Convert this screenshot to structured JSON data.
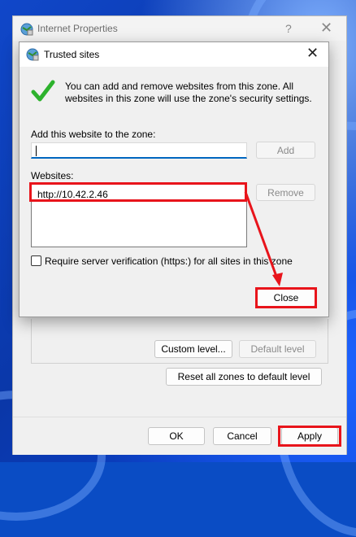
{
  "parent_window": {
    "title": "Internet Properties",
    "help_glyph": "?",
    "close_glyph": "✕",
    "custom_level_label": "Custom level...",
    "default_level_label": "Default level",
    "reset_all_label": "Reset all zones to default level",
    "ok_label": "OK",
    "cancel_label": "Cancel",
    "apply_label": "Apply"
  },
  "dialog": {
    "title": "Trusted sites",
    "close_glyph": "✕",
    "info_text": "You can add and remove websites from this zone. All websites in this zone will use the zone's security settings.",
    "add_site_label": "Add this website to the zone:",
    "add_site_value": "",
    "add_button_label": "Add",
    "websites_label": "Websites:",
    "websites": [
      "http://10.42.2.46"
    ],
    "remove_button_label": "Remove",
    "require_https_label": "Require server verification (https:) for all sites in this zone",
    "require_https_checked": false,
    "close_button_label": "Close"
  },
  "colors": {
    "highlight": "#e8141b",
    "accent": "#0067c0",
    "check_green": "#2db22d"
  },
  "icons": {
    "window_icon": "internet-options-icon",
    "check_icon": "green-checkmark-icon"
  }
}
